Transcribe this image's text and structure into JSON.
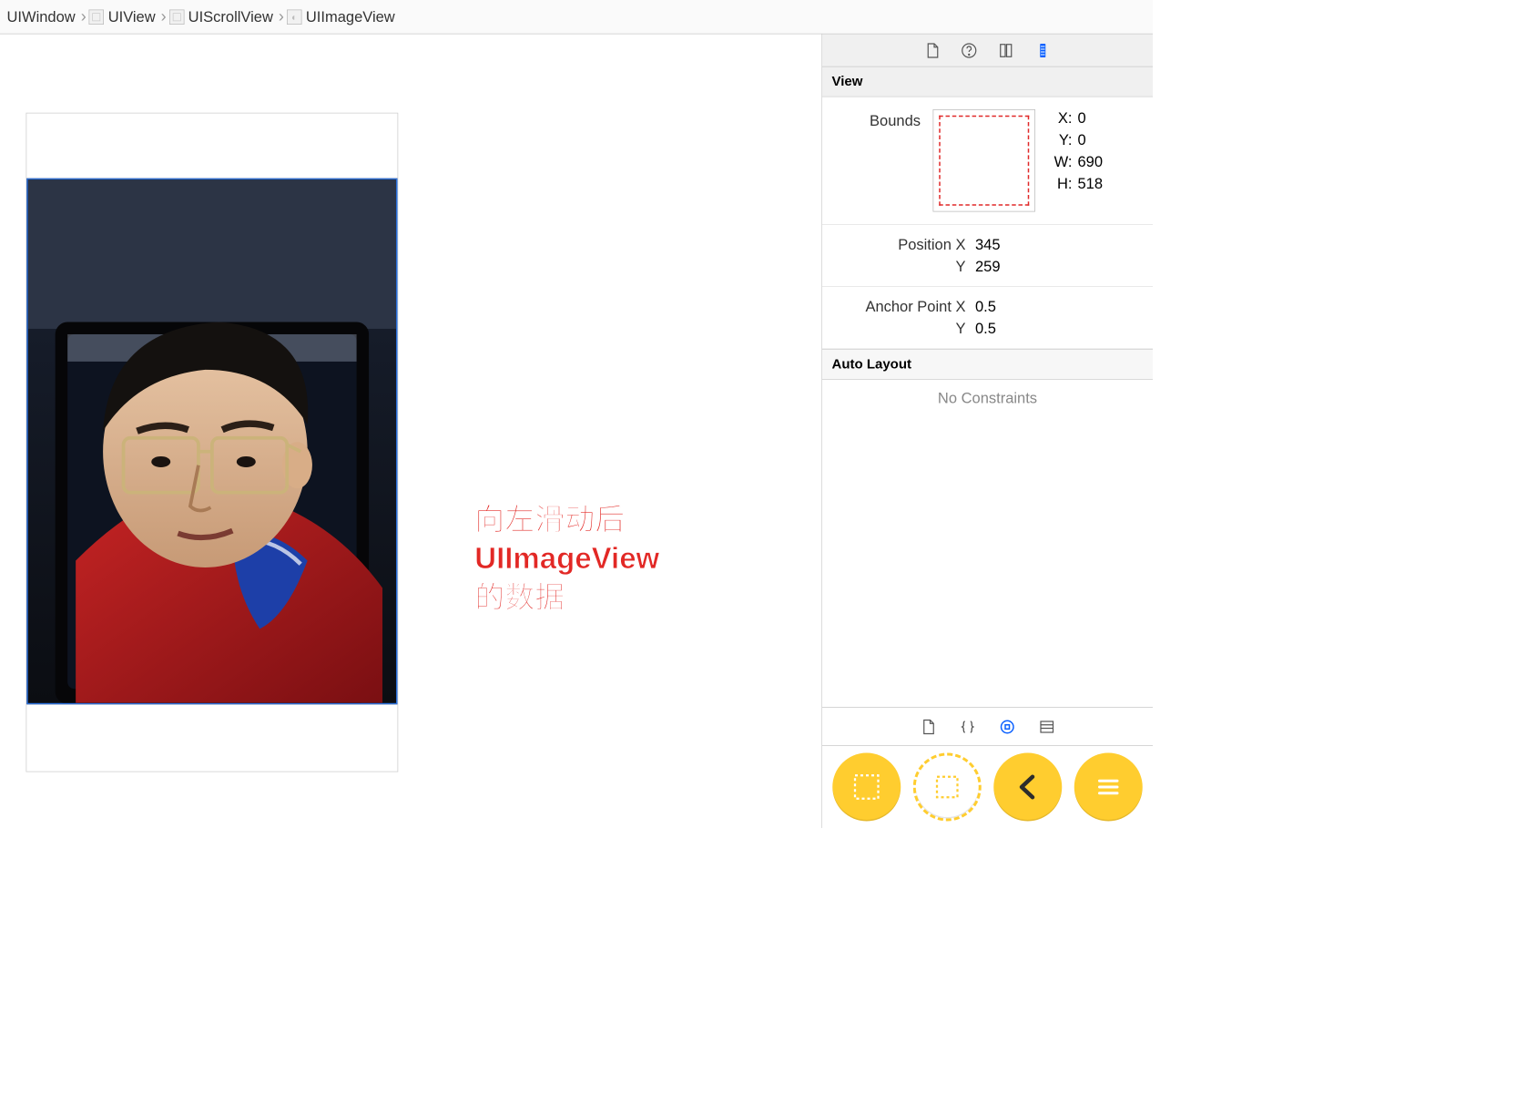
{
  "breadcrumb": [
    {
      "label": "UIWindow",
      "icon": null
    },
    {
      "label": "UIView",
      "icon": "box"
    },
    {
      "label": "UIScrollView",
      "icon": "box"
    },
    {
      "label": "UIImageView",
      "icon": "image"
    }
  ],
  "annotation": "向左滑动后\nUIImageView的数据",
  "inspector": {
    "tabs": [
      "file",
      "help",
      "identity",
      "size"
    ],
    "active_tab": "size",
    "section_view": "View",
    "bounds": {
      "label": "Bounds",
      "x_label": "X:",
      "x": "0",
      "y_label": "Y:",
      "y": "0",
      "w_label": "W:",
      "w": "690",
      "h_label": "H:",
      "h": "518"
    },
    "position": {
      "x_label": "Position X",
      "x": "345",
      "y_label": "Y",
      "y": "259"
    },
    "anchor": {
      "x_label": "Anchor Point X",
      "x": "0.5",
      "y_label": "Y",
      "y": "0.5"
    },
    "auto_layout": {
      "header": "Auto Layout",
      "no_constraints": "No Constraints"
    },
    "sub_tabs": [
      "file",
      "braces",
      "target",
      "list"
    ],
    "active_sub_tab": "target"
  }
}
